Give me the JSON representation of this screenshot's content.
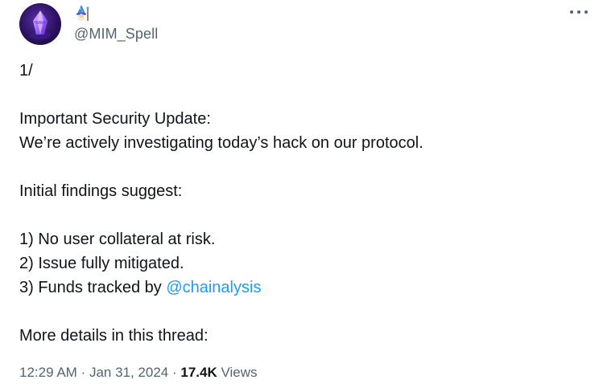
{
  "author": {
    "handle": "@MIM_Spell",
    "avatar_icon": "purple-crystal-avatar",
    "badge_icon": "wizard-emoji-icon"
  },
  "more_icon": "more-options-icon",
  "tweet": {
    "lines": [
      "1/",
      "",
      "Important Security Update:",
      "We’re actively investigating today’s hack on our protocol.",
      "",
      "Initial findings suggest:",
      "",
      "1) No user collateral at risk.",
      "2) Issue fully mitigated.",
      "3) Funds tracked by ",
      "",
      "More details in this thread:"
    ],
    "mention": "@chainalysis"
  },
  "meta": {
    "time": "12:29 AM",
    "separator": " · ",
    "date": "Jan 31, 2024",
    "views_count": "17.4K",
    "views_label": " Views"
  },
  "colors": {
    "text": "#0f1419",
    "secondary": "#536471",
    "link": "#1d9bf0"
  }
}
